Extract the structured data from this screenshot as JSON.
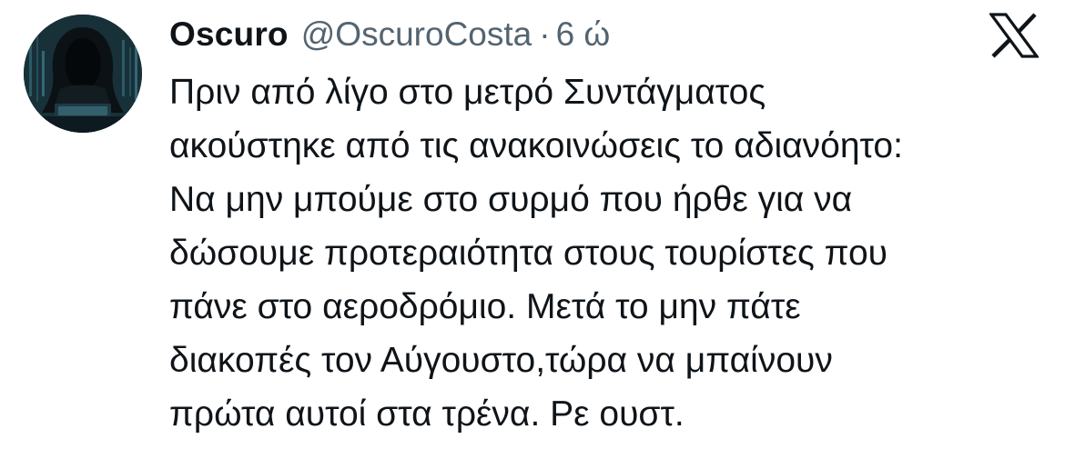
{
  "tweet": {
    "display_name": "Oscuro",
    "handle": "@OscuroCosta",
    "separator": "·",
    "time": "6 ώ",
    "platform_icon": "x-logo-icon",
    "avatar_icon": "hooded-figure-avatar",
    "text_lines": [
      "Πριν από λίγο στο μετρό Συντάγματος",
      "ακούστηκε από τις ανακοινώσεις το αδιανόητο:",
      "Να μην μπούμε στο συρμό που ήρθε για να",
      "δώσουμε προτεραιότητα στους τουρίστες που",
      "πάνε στο αεροδρόμιο. Μετά το μην πάτε",
      "διακοπές τον Αύγουστο,τώρα να μπαίνουν",
      "πρώτα αυτοί στα τρένα. Ρε ουστ."
    ]
  }
}
